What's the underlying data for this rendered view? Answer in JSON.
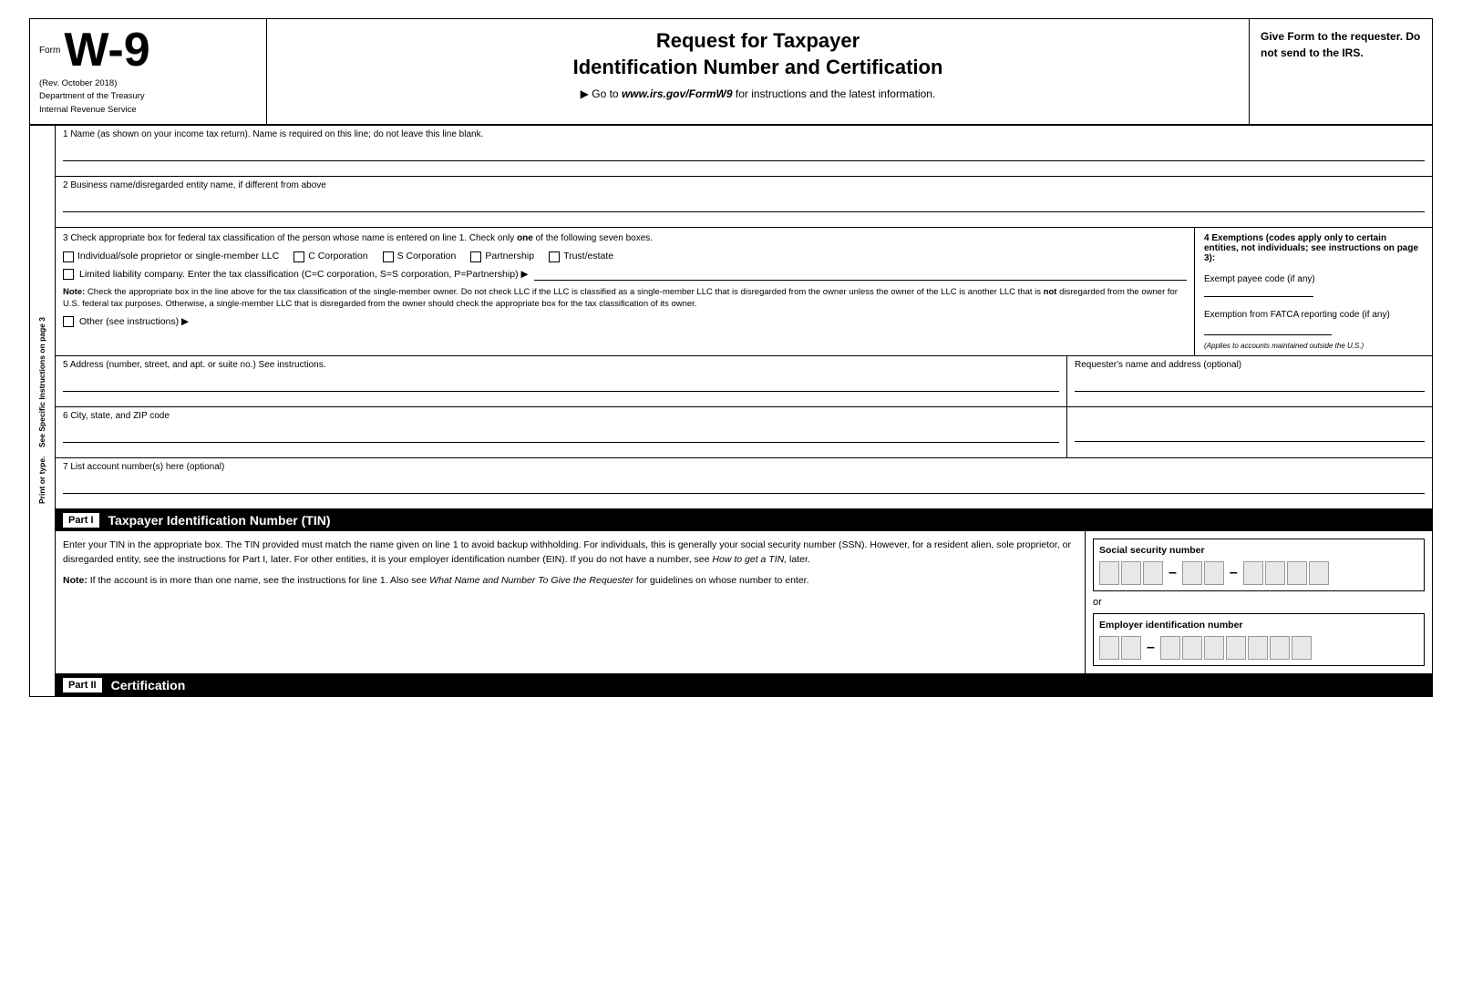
{
  "header": {
    "form_label": "Form",
    "form_number": "W-9",
    "rev_date": "(Rev. October 2018)",
    "dept": "Department of the Treasury",
    "irs": "Internal Revenue Service",
    "title_line1": "Request for Taxpayer",
    "title_line2": "Identification Number and Certification",
    "go_to": "▶ Go to",
    "website": "www.irs.gov/FormW9",
    "instructions": "for instructions and the latest information.",
    "give_form": "Give Form to the requester. Do not send to the IRS."
  },
  "sidebar": {
    "text1": "Print or type.",
    "text2": "See Specific Instructions on page 3"
  },
  "fields": {
    "line1_label": "1  Name (as shown on your income tax return). Name is required on this line; do not leave this line blank.",
    "line2_label": "2  Business name/disregarded entity name, if different from above",
    "line3_label": "3  Check appropriate box for federal tax classification of the person whose name is entered on line 1. Check only",
    "line3_label_bold": "one",
    "line3_label2": "of the following seven boxes.",
    "checkbox_individual": "Individual/sole proprietor or single-member LLC",
    "checkbox_c_corp": "C Corporation",
    "checkbox_s_corp": "S Corporation",
    "checkbox_partnership": "Partnership",
    "checkbox_trust": "Trust/estate",
    "llc_label": "Limited liability company. Enter the tax classification (C=C corporation, S=S corporation, P=Partnership) ▶",
    "note_label": "Note:",
    "note_text": "Check the appropriate box in the line above for the tax classification of the single-member owner. Do not check LLC if the LLC is classified as a single-member LLC that is disregarded from the owner unless the owner of the LLC is another LLC that is",
    "note_bold": "not",
    "note_text2": "disregarded from the owner for U.S. federal tax purposes. Otherwise, a single-member LLC that is disregarded from the owner should check the appropriate box for the tax classification of its owner.",
    "other_label": "Other (see instructions) ▶",
    "line4_label": "4  Exemptions (codes apply only to certain entities, not individuals; see instructions on page 3):",
    "exempt_payee_label": "Exempt payee code (if any)",
    "fatca_label": "Exemption from FATCA reporting code (if any)",
    "applies_text": "(Applies to accounts maintained outside the U.S.)",
    "line5_label": "5  Address (number, street, and apt. or suite no.) See instructions.",
    "requester_label": "Requester's name and address (optional)",
    "line6_label": "6  City, state, and ZIP code",
    "line7_label": "7  List account number(s) here (optional)"
  },
  "part1": {
    "label": "Part I",
    "title": "Taxpayer Identification Number (TIN)",
    "instructions": "Enter your TIN in the appropriate box. The TIN provided must match the name given on line 1 to avoid backup withholding. For individuals, this is generally your social security number (SSN). However, for a resident alien, sole proprietor, or disregarded entity, see the instructions for Part I, later. For other entities, it is your employer identification number (EIN). If you do not have a number, see",
    "how_to_get": "How to get a TIN,",
    "instructions2": "later.",
    "note": "Note:",
    "note_text": "If the account is in more than one name, see the instructions for line 1. Also see",
    "what_name": "What Name and Number To Give the Requester",
    "note_text2": "for guidelines on whose number to enter.",
    "ssn_label": "Social security number",
    "or_text": "or",
    "ein_label": "Employer identification number"
  },
  "part2": {
    "label": "Part II",
    "title": "Certification"
  }
}
